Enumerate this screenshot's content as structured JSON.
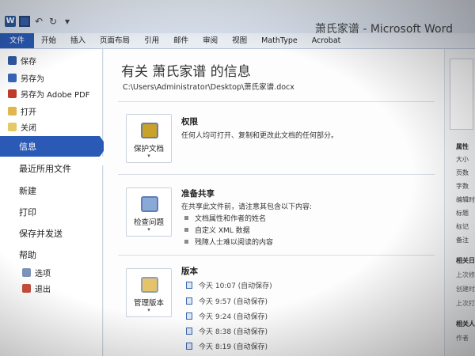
{
  "window": {
    "title": "萧氏家谱 - Microsoft Word",
    "logo_letter": "W"
  },
  "ribbon": {
    "tabs": [
      "文件",
      "开始",
      "插入",
      "页面布局",
      "引用",
      "邮件",
      "审阅",
      "视图",
      "MathType",
      "Acrobat"
    ]
  },
  "nav": {
    "save": "保存",
    "save_as": "另存为",
    "save_as_pdf": "另存为 Adobe PDF",
    "open": "打开",
    "close": "关闭",
    "info": "信息",
    "recent": "最近所用文件",
    "new": "新建",
    "print": "打印",
    "save_send": "保存并发送",
    "help": "帮助",
    "options": "选项",
    "exit": "退出"
  },
  "info": {
    "heading": "有关 萧氏家谱 的信息",
    "path": "C:\\Users\\Administrator\\Desktop\\萧氏家谱.docx",
    "permissions": {
      "button": "保护文档",
      "title": "权限",
      "text": "任何人均可打开、复制和更改此文档的任何部分。"
    },
    "prepare": {
      "button": "检查问题",
      "title": "准备共享",
      "text": "在共享此文件前，请注意其包含以下内容:",
      "items": [
        "文档属性和作者的姓名",
        "自定义 XML 数据",
        "残障人士难以阅读的内容"
      ]
    },
    "versions": {
      "button": "管理版本",
      "title": "版本",
      "items": [
        "今天 10:07 (自动保存)",
        "今天 9:57 (自动保存)",
        "今天 9:24 (自动保存)",
        "今天 8:38 (自动保存)",
        "今天 8:19 (自动保存)"
      ]
    }
  },
  "properties": {
    "header": "属性",
    "labels": [
      "大小",
      "页数",
      "字数",
      "编辑时",
      "标题",
      "标记",
      "备注"
    ],
    "related_dates": "相关日",
    "date_labels": [
      "上次修",
      "创建时",
      "上次打"
    ],
    "related_people": "相关人员",
    "author": "作者"
  },
  "colors": {
    "accent": "#2a5ab5",
    "nav_bg": "#ffffff",
    "main_bg": "#fdfdfd"
  }
}
